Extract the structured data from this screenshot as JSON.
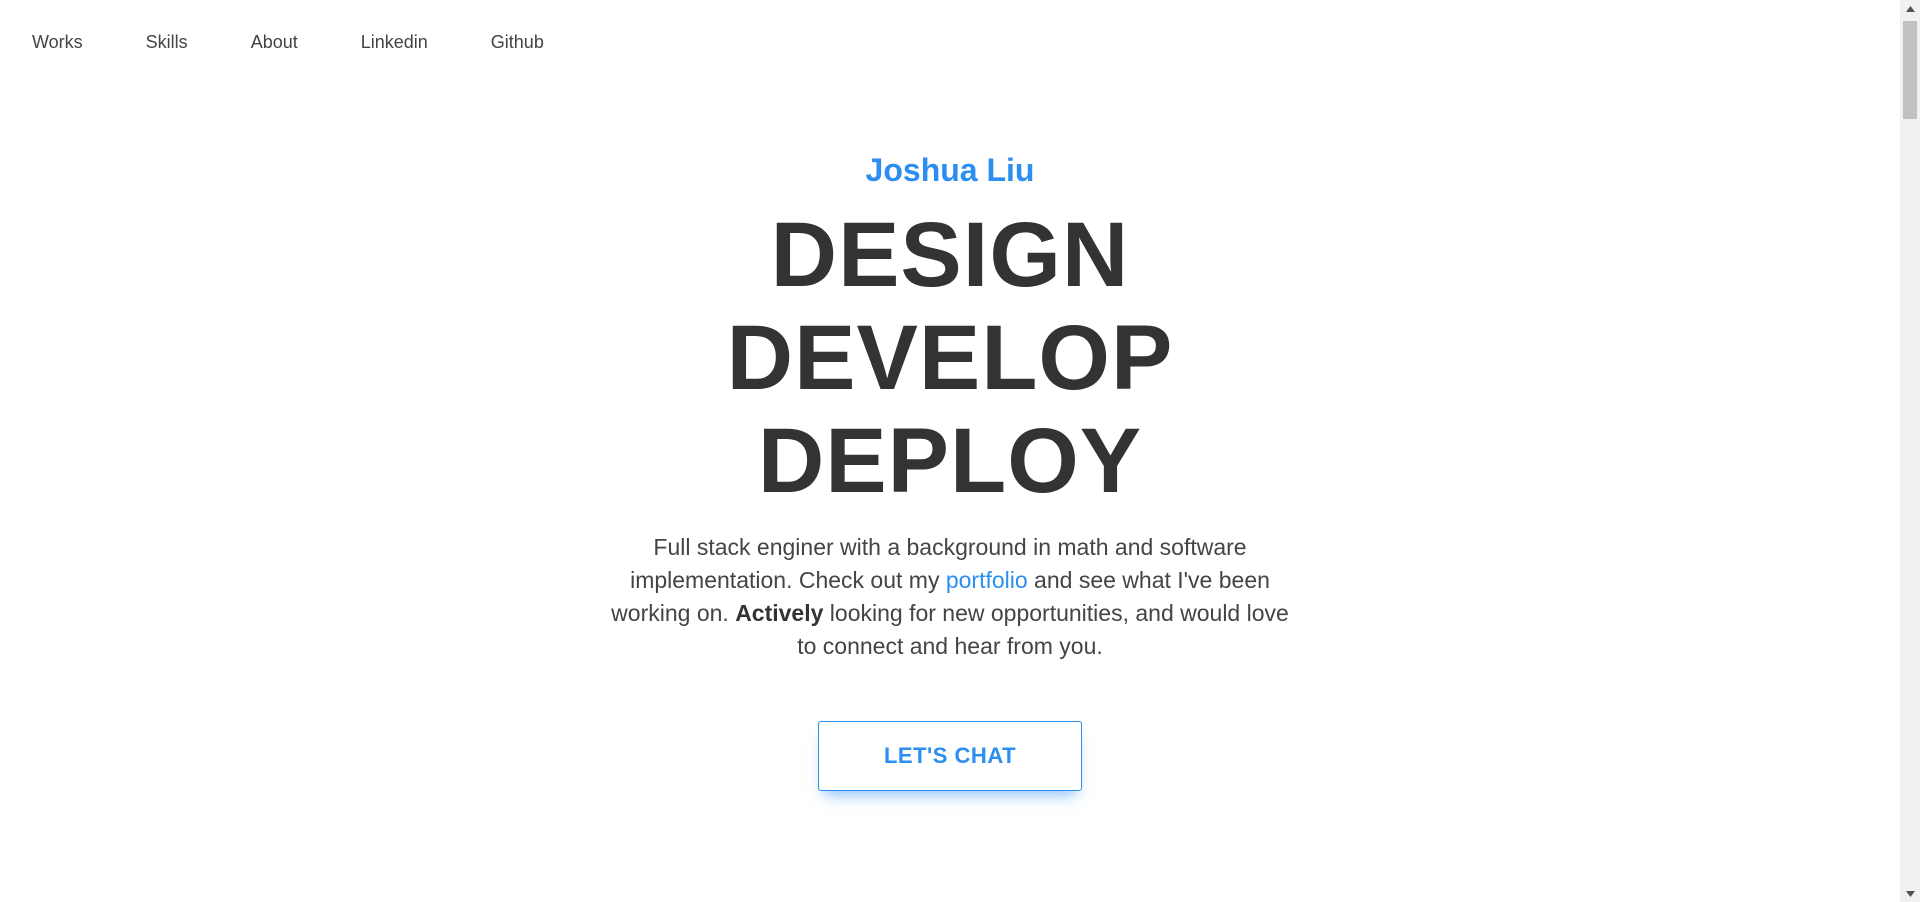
{
  "nav": {
    "items": [
      {
        "label": "Works"
      },
      {
        "label": "Skills"
      },
      {
        "label": "About"
      },
      {
        "label": "Linkedin"
      },
      {
        "label": "Github"
      }
    ]
  },
  "hero": {
    "name": "Joshua Liu",
    "headline": [
      "DESIGN",
      "DEVELOP",
      "DEPLOY"
    ],
    "intro": {
      "part1": "Full stack enginer with a background in math and software implementation. Check out my ",
      "link": "portfolio",
      "part2": " and see what I've been working on. ",
      "bold": "Actively",
      "part3": " looking for new opportunities, and would love to connect and hear from you."
    },
    "cta_label": "LET'S CHAT"
  },
  "colors": {
    "accent": "#2b8ef0",
    "text": "#333333"
  },
  "scrollbar": {
    "up_icon": "scroll-up-arrow-icon",
    "down_icon": "scroll-down-arrow-icon"
  }
}
